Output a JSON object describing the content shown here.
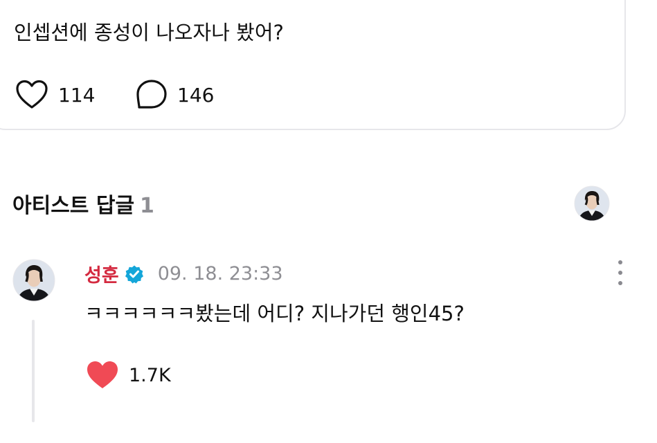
{
  "post": {
    "text": "인셉션에 종성이 나오자나 봤어?",
    "like_count": "114",
    "comment_count": "146"
  },
  "section": {
    "title": "아티스트 답글",
    "count": "1"
  },
  "reply": {
    "author": "성훈",
    "timestamp": "09. 18. 23:33",
    "text": "ㅋㅋㅋㅋㅋㅋ봤는데 어디? 지나가던 행인45?",
    "like_count": "1.7K"
  },
  "colors": {
    "author_name": "#d42a40",
    "liked_heart": "#f04a55",
    "verified_badge": "#14a6d9",
    "muted_text": "#8e8e93"
  }
}
